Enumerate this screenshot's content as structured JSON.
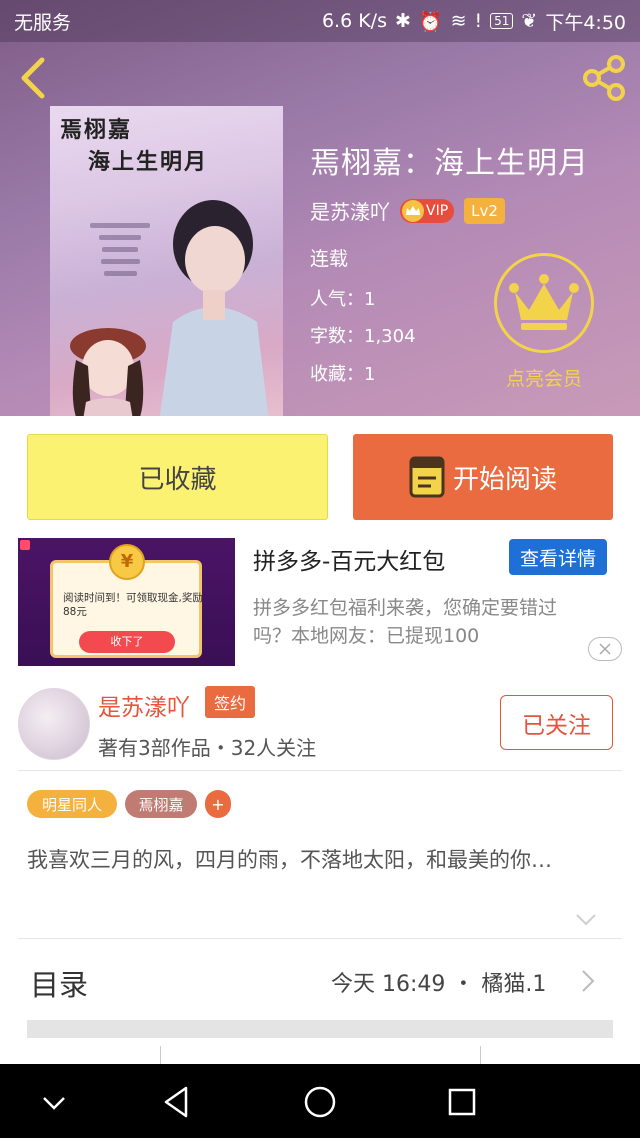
{
  "status_bar": {
    "carrier": "无服务",
    "speed": "6.6 K/s",
    "battery": "51",
    "time": "下午4:50"
  },
  "book": {
    "cover_title_line1": "焉栩嘉",
    "cover_title_line2": "海上生明月",
    "title": "焉栩嘉：海上生明月",
    "author": "是苏漾吖",
    "vip_label": "VIP",
    "level": "Lv2",
    "status": "连载",
    "popularity": "人气：1",
    "word_count": "字数：1,304",
    "favorites": "收藏：1",
    "vip_member_label": "点亮会员"
  },
  "actions": {
    "favorite_label": "已收藏",
    "read_label": "开始阅读"
  },
  "ad": {
    "image_coin": "¥",
    "image_text": "阅读时间到！可领取现金,奖励88元",
    "image_button": "收下了",
    "title": "拼多多-百元大红包",
    "detail_button": "查看详情",
    "description": "拼多多红包福利来袭，您确定要错过吗？本地网友：已提现100"
  },
  "author_info": {
    "name": "是苏漾吖",
    "signed_badge": "签约",
    "meta": "著有3部作品・32人关注",
    "follow_label": "已关注"
  },
  "tags": [
    "明星同人",
    "焉栩嘉",
    "+"
  ],
  "summary": "我喜欢三月的风，四月的雨，不落地太阳，和最美的你…",
  "toc": {
    "label": "目录",
    "update": "今天  16:49  ・  橘猫.1"
  },
  "colors": {
    "accent_orange": "#ea6b3f",
    "favorite_yellow": "#fcf272",
    "author_red": "#e7543a",
    "ad_blue": "#1e6fd6",
    "vip_gold": "#f2d34a"
  }
}
